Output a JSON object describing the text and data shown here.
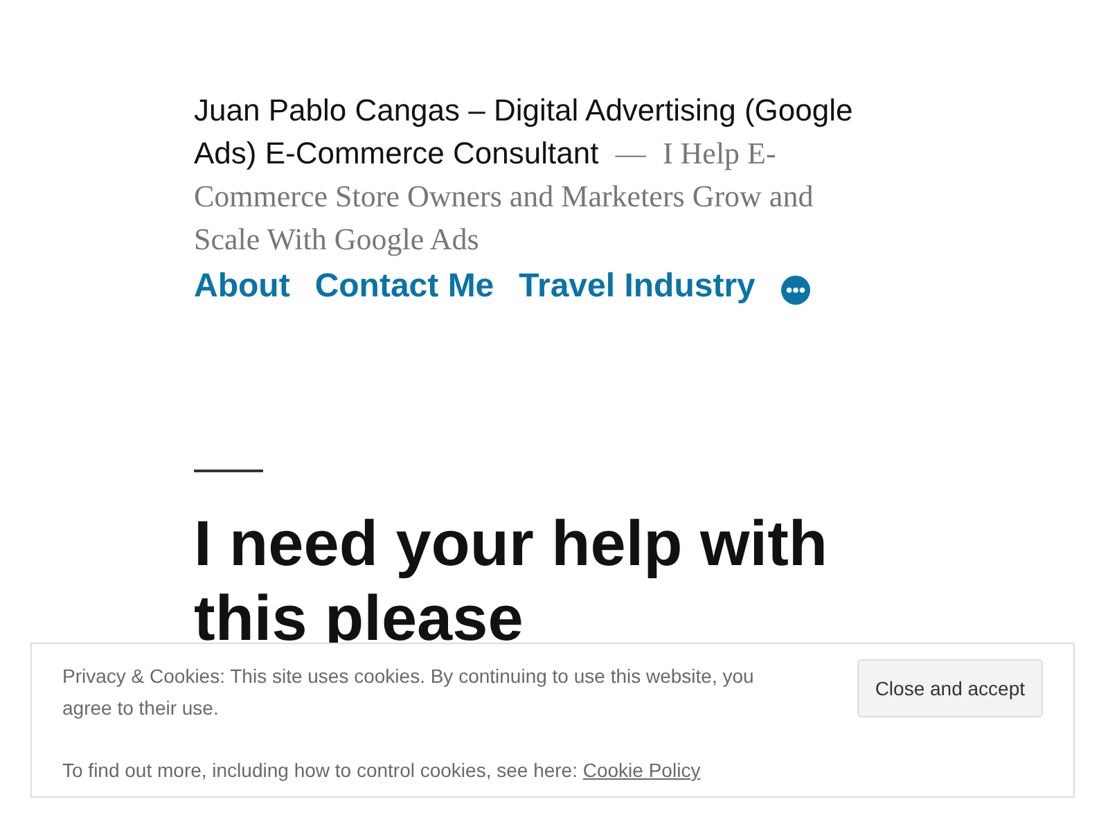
{
  "site": {
    "title": "Juan Pablo Cangas – Digital Advertising (Google Ads) E-Commerce Consultant",
    "separator": "—",
    "description": "I Help E-Commerce Store Owners and Marketers Grow and Scale With Google Ads"
  },
  "nav": {
    "items": [
      "About",
      "Contact Me",
      "Travel Industry"
    ]
  },
  "post": {
    "title": "I need your help with this please"
  },
  "cookie_banner": {
    "text": "Privacy & Cookies: This site uses cookies. By continuing to use this website, you agree to their use.",
    "more": "To find out more, including how to control cookies, see here:",
    "link": "Cookie Policy",
    "button": "Close and accept"
  }
}
